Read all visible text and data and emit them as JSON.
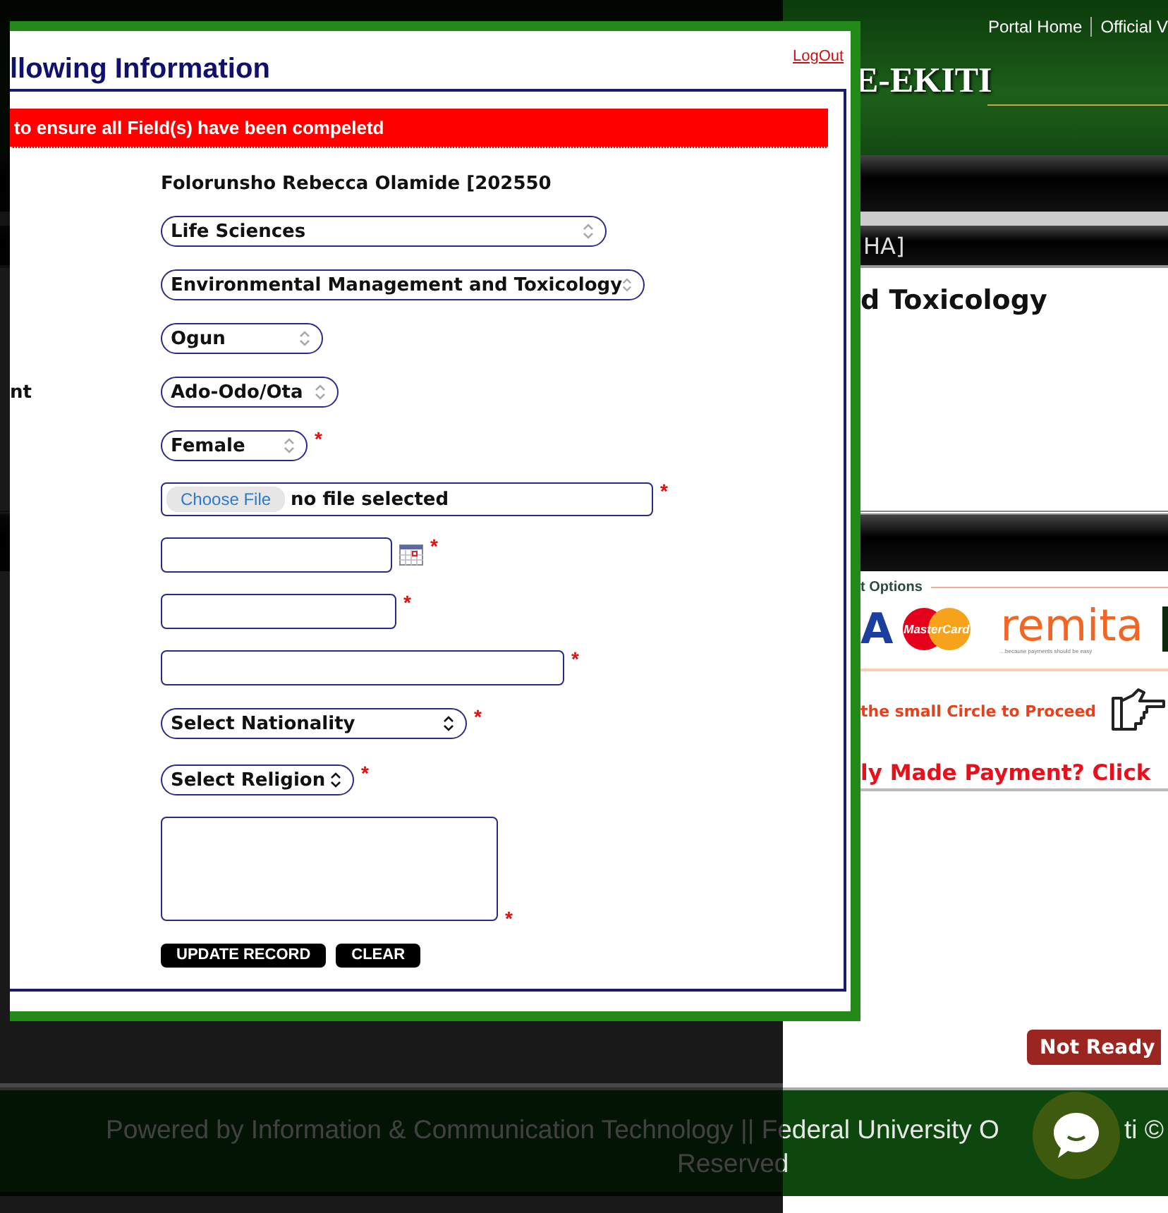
{
  "background": {
    "header_links": [
      "Portal Home",
      "Official V"
    ],
    "site_title": "E-EKITI",
    "bar_text": "HA]",
    "heading": "d Toxicology",
    "payment_options_label": "t Options",
    "payment_logos": {
      "visa": "A",
      "mastercard": "MasterCard",
      "remita": "remita",
      "remita_tagline": "...because payments should be easy"
    },
    "proceed_text": "the small Circle to Proceed",
    "payment_link": "ly Made Payment? Click",
    "not_ready_button": "Not Ready",
    "footer": {
      "line_1_start": "Powered by Information & Communication Technology || Federal University O",
      "line_1_end": "ti ©",
      "line_2": "Reserved"
    }
  },
  "modal": {
    "title": "llowing Information",
    "logout_link": "LogOut",
    "alert": "to ensure all Field(s) have been compeletd",
    "student_name": "Folorunsho Rebecca Olamide [202550",
    "required_mark": "*",
    "fields": [
      {
        "kind": "select",
        "value": "Life Sciences",
        "required": false
      },
      {
        "kind": "select",
        "value": "Environmental Management and Toxicology",
        "required": false
      },
      {
        "kind": "select",
        "value": "Ogun",
        "required": false
      },
      {
        "kind": "select",
        "label": "nt",
        "value": "Ado-Odo/Ota",
        "required": false
      },
      {
        "kind": "select",
        "value": "Female",
        "required": true
      },
      {
        "kind": "file",
        "button": "Choose File",
        "status": "no file selected",
        "required": true
      },
      {
        "kind": "date",
        "required": true
      },
      {
        "kind": "text",
        "required": true
      },
      {
        "kind": "text",
        "required": true
      },
      {
        "kind": "select",
        "placeholder": "Select Nationality",
        "required": true
      },
      {
        "kind": "select",
        "placeholder": "Select Religion",
        "required": true
      },
      {
        "kind": "textarea",
        "required": true
      }
    ],
    "buttons": [
      "UPDATE RECORD",
      "CLEAR"
    ]
  }
}
